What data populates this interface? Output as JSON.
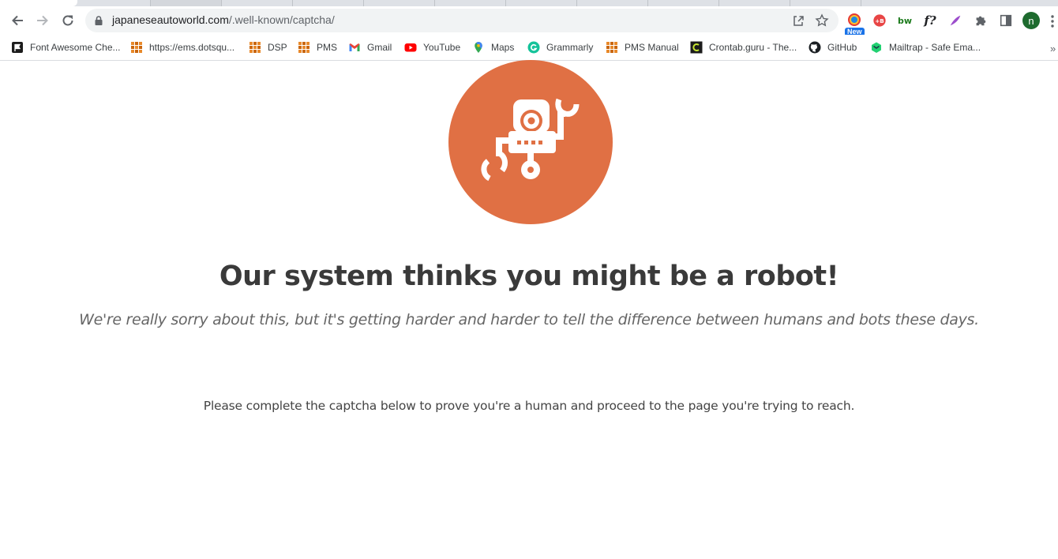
{
  "browser": {
    "url_host": "japaneseautoworld.com",
    "url_path": "/.well-known/captcha/",
    "ext_new_badge": "New",
    "profile_initial": "n",
    "bookmarks": [
      {
        "label": "Font Awesome Che...",
        "icon": "font-awesome-icon"
      },
      {
        "label": "https://ems.dotsqu...",
        "icon": "app-grid-icon"
      },
      {
        "label": "DSP",
        "icon": "app-grid-icon"
      },
      {
        "label": "PMS",
        "icon": "app-grid-icon"
      },
      {
        "label": "Gmail",
        "icon": "gmail-icon"
      },
      {
        "label": "YouTube",
        "icon": "youtube-icon"
      },
      {
        "label": "Maps",
        "icon": "maps-icon"
      },
      {
        "label": "Grammarly",
        "icon": "grammarly-icon"
      },
      {
        "label": "PMS Manual",
        "icon": "app-grid-icon"
      },
      {
        "label": "Crontab.guru - The...",
        "icon": "crontab-icon"
      },
      {
        "label": "GitHub",
        "icon": "github-icon"
      },
      {
        "label": "Mailtrap - Safe Ema...",
        "icon": "mailtrap-icon"
      }
    ],
    "bookmarks_overflow": "»"
  },
  "page": {
    "illustration": "robot-icon",
    "accent_color": "#e07044",
    "headline": "Our system thinks you might be a robot!",
    "subline": "We're really sorry about this, but it's getting harder and harder to tell the difference between humans and bots these days.",
    "instructions": "Please complete the captcha below to prove you're a human and proceed to the page you're trying to reach."
  }
}
